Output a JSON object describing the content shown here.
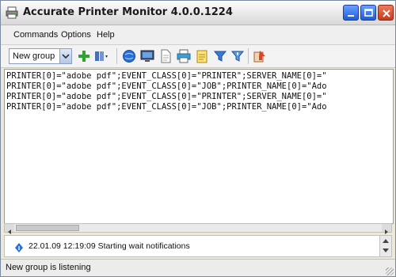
{
  "window": {
    "title": "Accurate Printer Monitor 4.0.0.1224"
  },
  "menu": {
    "items": [
      "Commands",
      "Options",
      "Help"
    ]
  },
  "toolbar": {
    "group_select_value": "New group",
    "icons": [
      "add-icon",
      "columns-icon",
      "globe-icon",
      "monitor-icon",
      "document-icon",
      "printer-icon",
      "notepad-icon",
      "filter-blue-icon",
      "filter-alt-icon",
      "export-icon"
    ]
  },
  "log": {
    "lines": [
      "PRINTER[0]=\"adobe pdf\";EVENT_CLASS[0]=\"PRINTER\";SERVER_NAME[0]=\"",
      "PRINTER[0]=\"adobe pdf\";EVENT_CLASS[0]=\"JOB\";PRINTER_NAME[0]=\"Ado",
      "PRINTER[0]=\"adobe pdf\";EVENT_CLASS[0]=\"PRINTER\";SERVER_NAME[0]=\"",
      "PRINTER[0]=\"adobe pdf\";EVENT_CLASS[0]=\"JOB\";PRINTER_NAME[0]=\"Ado"
    ]
  },
  "notification": {
    "text": "22.01.09 12:19:09 Starting wait notifications"
  },
  "status": {
    "text": "New group is listening"
  },
  "colors": {
    "accent_blue": "#1f5bd8",
    "close_red": "#c8391c",
    "add_green": "#2fa32f"
  }
}
